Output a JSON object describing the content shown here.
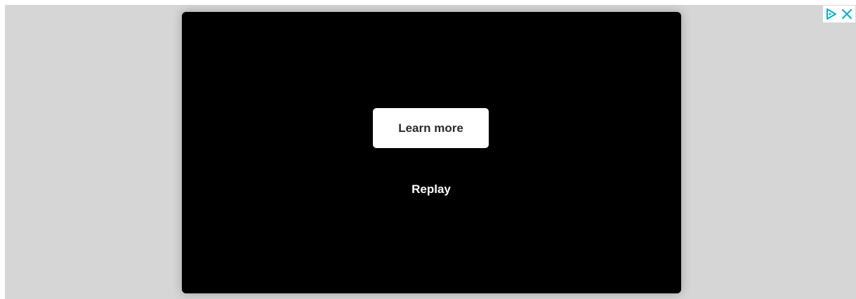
{
  "ad": {
    "cta_label": "Learn more",
    "replay_label": "Replay"
  },
  "adchoices": {
    "info_icon": "adchoices-triangle-icon",
    "close_icon": "close-icon",
    "accent_color": "#00aecd"
  },
  "colors": {
    "frame_background": "#d6d6d6",
    "video_background": "#000000",
    "cta_background": "#ffffff",
    "cta_text": "#2a2a2a",
    "replay_text": "#ffffff"
  }
}
